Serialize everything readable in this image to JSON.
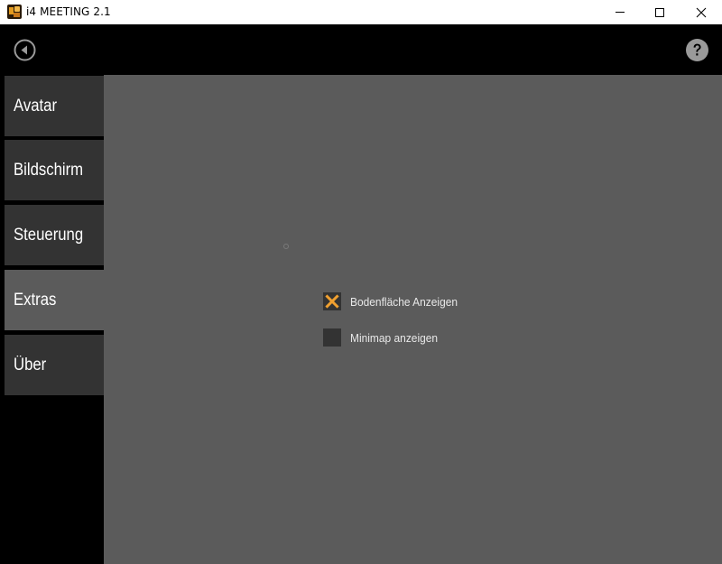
{
  "window": {
    "title": "i4 MEETING 2.1",
    "controls": [
      "minimize-icon",
      "maximize-icon",
      "close-icon"
    ]
  },
  "appbar": {
    "back_icon": "back-arrow-circle-icon",
    "help_icon": "help-question-icon"
  },
  "sidebar": {
    "items": [
      {
        "label": "Avatar",
        "active": false
      },
      {
        "label": "Bildschirm",
        "active": false
      },
      {
        "label": "Steuerung",
        "active": false
      },
      {
        "label": "Extras",
        "active": true
      },
      {
        "label": "Über",
        "active": false
      }
    ]
  },
  "extras": {
    "options": [
      {
        "label": "Bodenfläche Anzeigen",
        "checked": true
      },
      {
        "label": "Minimap anzeigen",
        "checked": false
      }
    ]
  },
  "colors": {
    "accent": "#f0a030",
    "panel": "#5b5b5b",
    "nav_item": "#333333",
    "background": "#000000"
  }
}
